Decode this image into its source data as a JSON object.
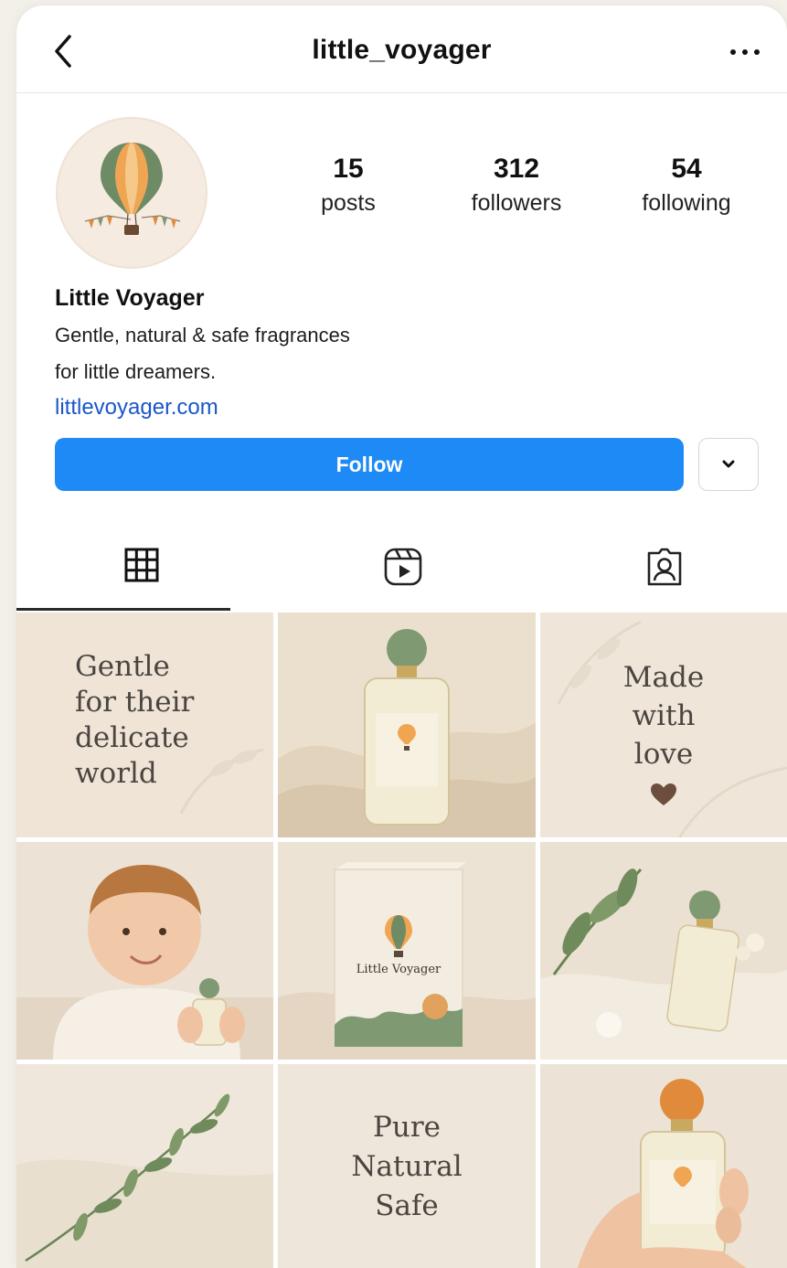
{
  "header": {
    "username": "little_voyager"
  },
  "profile": {
    "display_name": "Little Voyager",
    "bio_line1": "Gentle, natural & safe fragrances",
    "bio_line2": "for little dreamers.",
    "website": "littlevoyager.com",
    "stats": [
      {
        "value": "15",
        "label": "posts"
      },
      {
        "value": "312",
        "label": "followers"
      },
      {
        "value": "54",
        "label": "following"
      }
    ],
    "follow_label": "Follow"
  },
  "tabs": [
    {
      "icon": "grid-icon",
      "active": true
    },
    {
      "icon": "reels-icon",
      "active": false
    },
    {
      "icon": "tagged-icon",
      "active": false
    }
  ],
  "posts": [
    {
      "kind": "text",
      "text": "Gentle\nfor their\ndelicate\nworld"
    },
    {
      "kind": "image",
      "subject": "perfume bottle with green cap"
    },
    {
      "kind": "text",
      "text": "Made\nwith\nlove"
    },
    {
      "kind": "image",
      "subject": "baby holding perfume bottle"
    },
    {
      "kind": "image",
      "subject": "product box",
      "box_label": "Little Voyager"
    },
    {
      "kind": "image",
      "subject": "perfume bottle with leaves"
    },
    {
      "kind": "image",
      "subject": "leaf branch on fabric"
    },
    {
      "kind": "text",
      "text": "Pure\nNatural\nSafe"
    },
    {
      "kind": "image",
      "subject": "hand holding perfume bottle with orange cap"
    }
  ],
  "colors": {
    "follow_blue": "#1e8af5",
    "link_blue": "#1a56c8",
    "sage_green": "#7f9a72",
    "orange": "#e08a3c",
    "cream": "#efe6d9"
  }
}
